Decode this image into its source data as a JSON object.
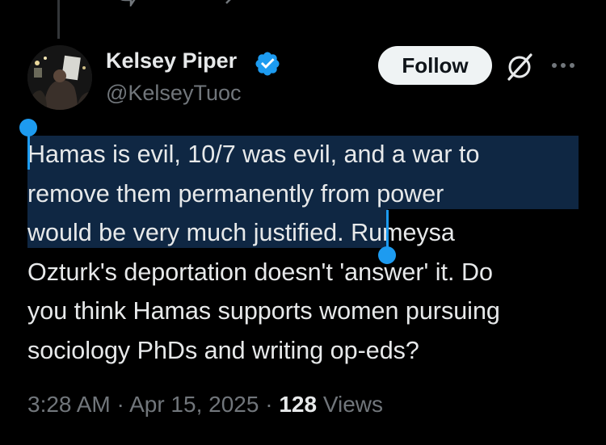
{
  "author": {
    "display_name": "Kelsey Piper",
    "handle": "@KelseyTuoc",
    "verified": true
  },
  "actions": {
    "follow_label": "Follow"
  },
  "tweet": {
    "lines": [
      "Hamas is evil, 10/7 was evil, and a war to",
      "remove them permanently from power",
      "would be very much justified. Rumeysa",
      "Ozturk's deportation doesn't 'answer' it. Do",
      "you think Hamas supports women pursuing",
      "sociology PhDs and writing op-eds?"
    ],
    "selected_text": "Hamas is evil, 10/7 was evil, and a war to remove them permanently from power would be very much justified"
  },
  "meta": {
    "time": "3:28 AM",
    "date": "Apr 15, 2025",
    "views_count": "128",
    "views_label": "Views",
    "separator": "·"
  },
  "colors": {
    "background": "#000000",
    "text": "#e7e9ea",
    "secondary": "#71767b",
    "accent": "#1d9bf0",
    "selection": "#0f2743"
  },
  "icons": {
    "verified": "verified-badge-icon",
    "grok": "grok-icon",
    "more": "more-icon"
  }
}
